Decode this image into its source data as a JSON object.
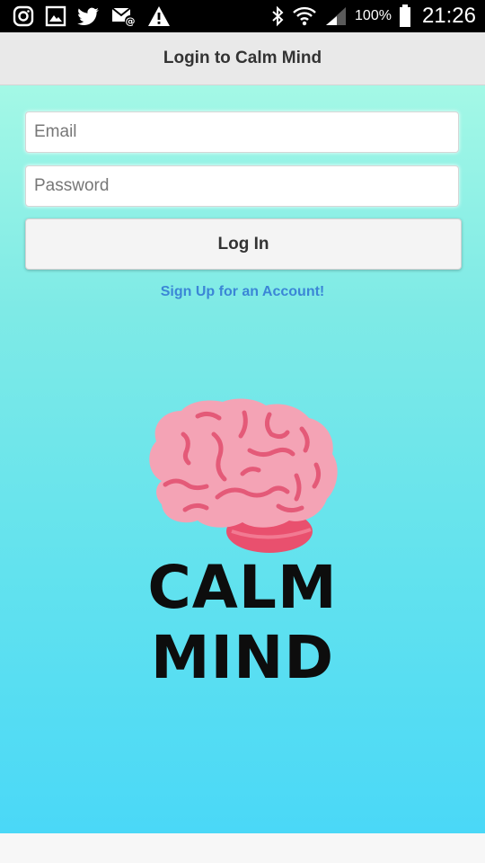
{
  "status_bar": {
    "icons_left": [
      "instagram-icon",
      "gallery-icon",
      "twitter-icon",
      "email-icon",
      "warning-icon"
    ],
    "icons_right": [
      "bluetooth-icon",
      "wifi-icon",
      "signal-icon",
      "battery-icon"
    ],
    "battery": "100%",
    "time": "21:26"
  },
  "header": {
    "title": "Login to Calm Mind"
  },
  "form": {
    "email_placeholder": "Email",
    "password_placeholder": "Password",
    "login_label": "Log In",
    "signup_label": "Sign Up for an Account!"
  },
  "logo": {
    "line1": "CALM",
    "line2": "MIND",
    "brain_color": "#f4a3b5",
    "brain_line_color": "#e45a78",
    "cerebellum_color": "#e9506e"
  },
  "colors": {
    "gradient_top": "#a4f8e6",
    "gradient_bottom": "#4ad8f7",
    "link": "#3b86d6"
  }
}
